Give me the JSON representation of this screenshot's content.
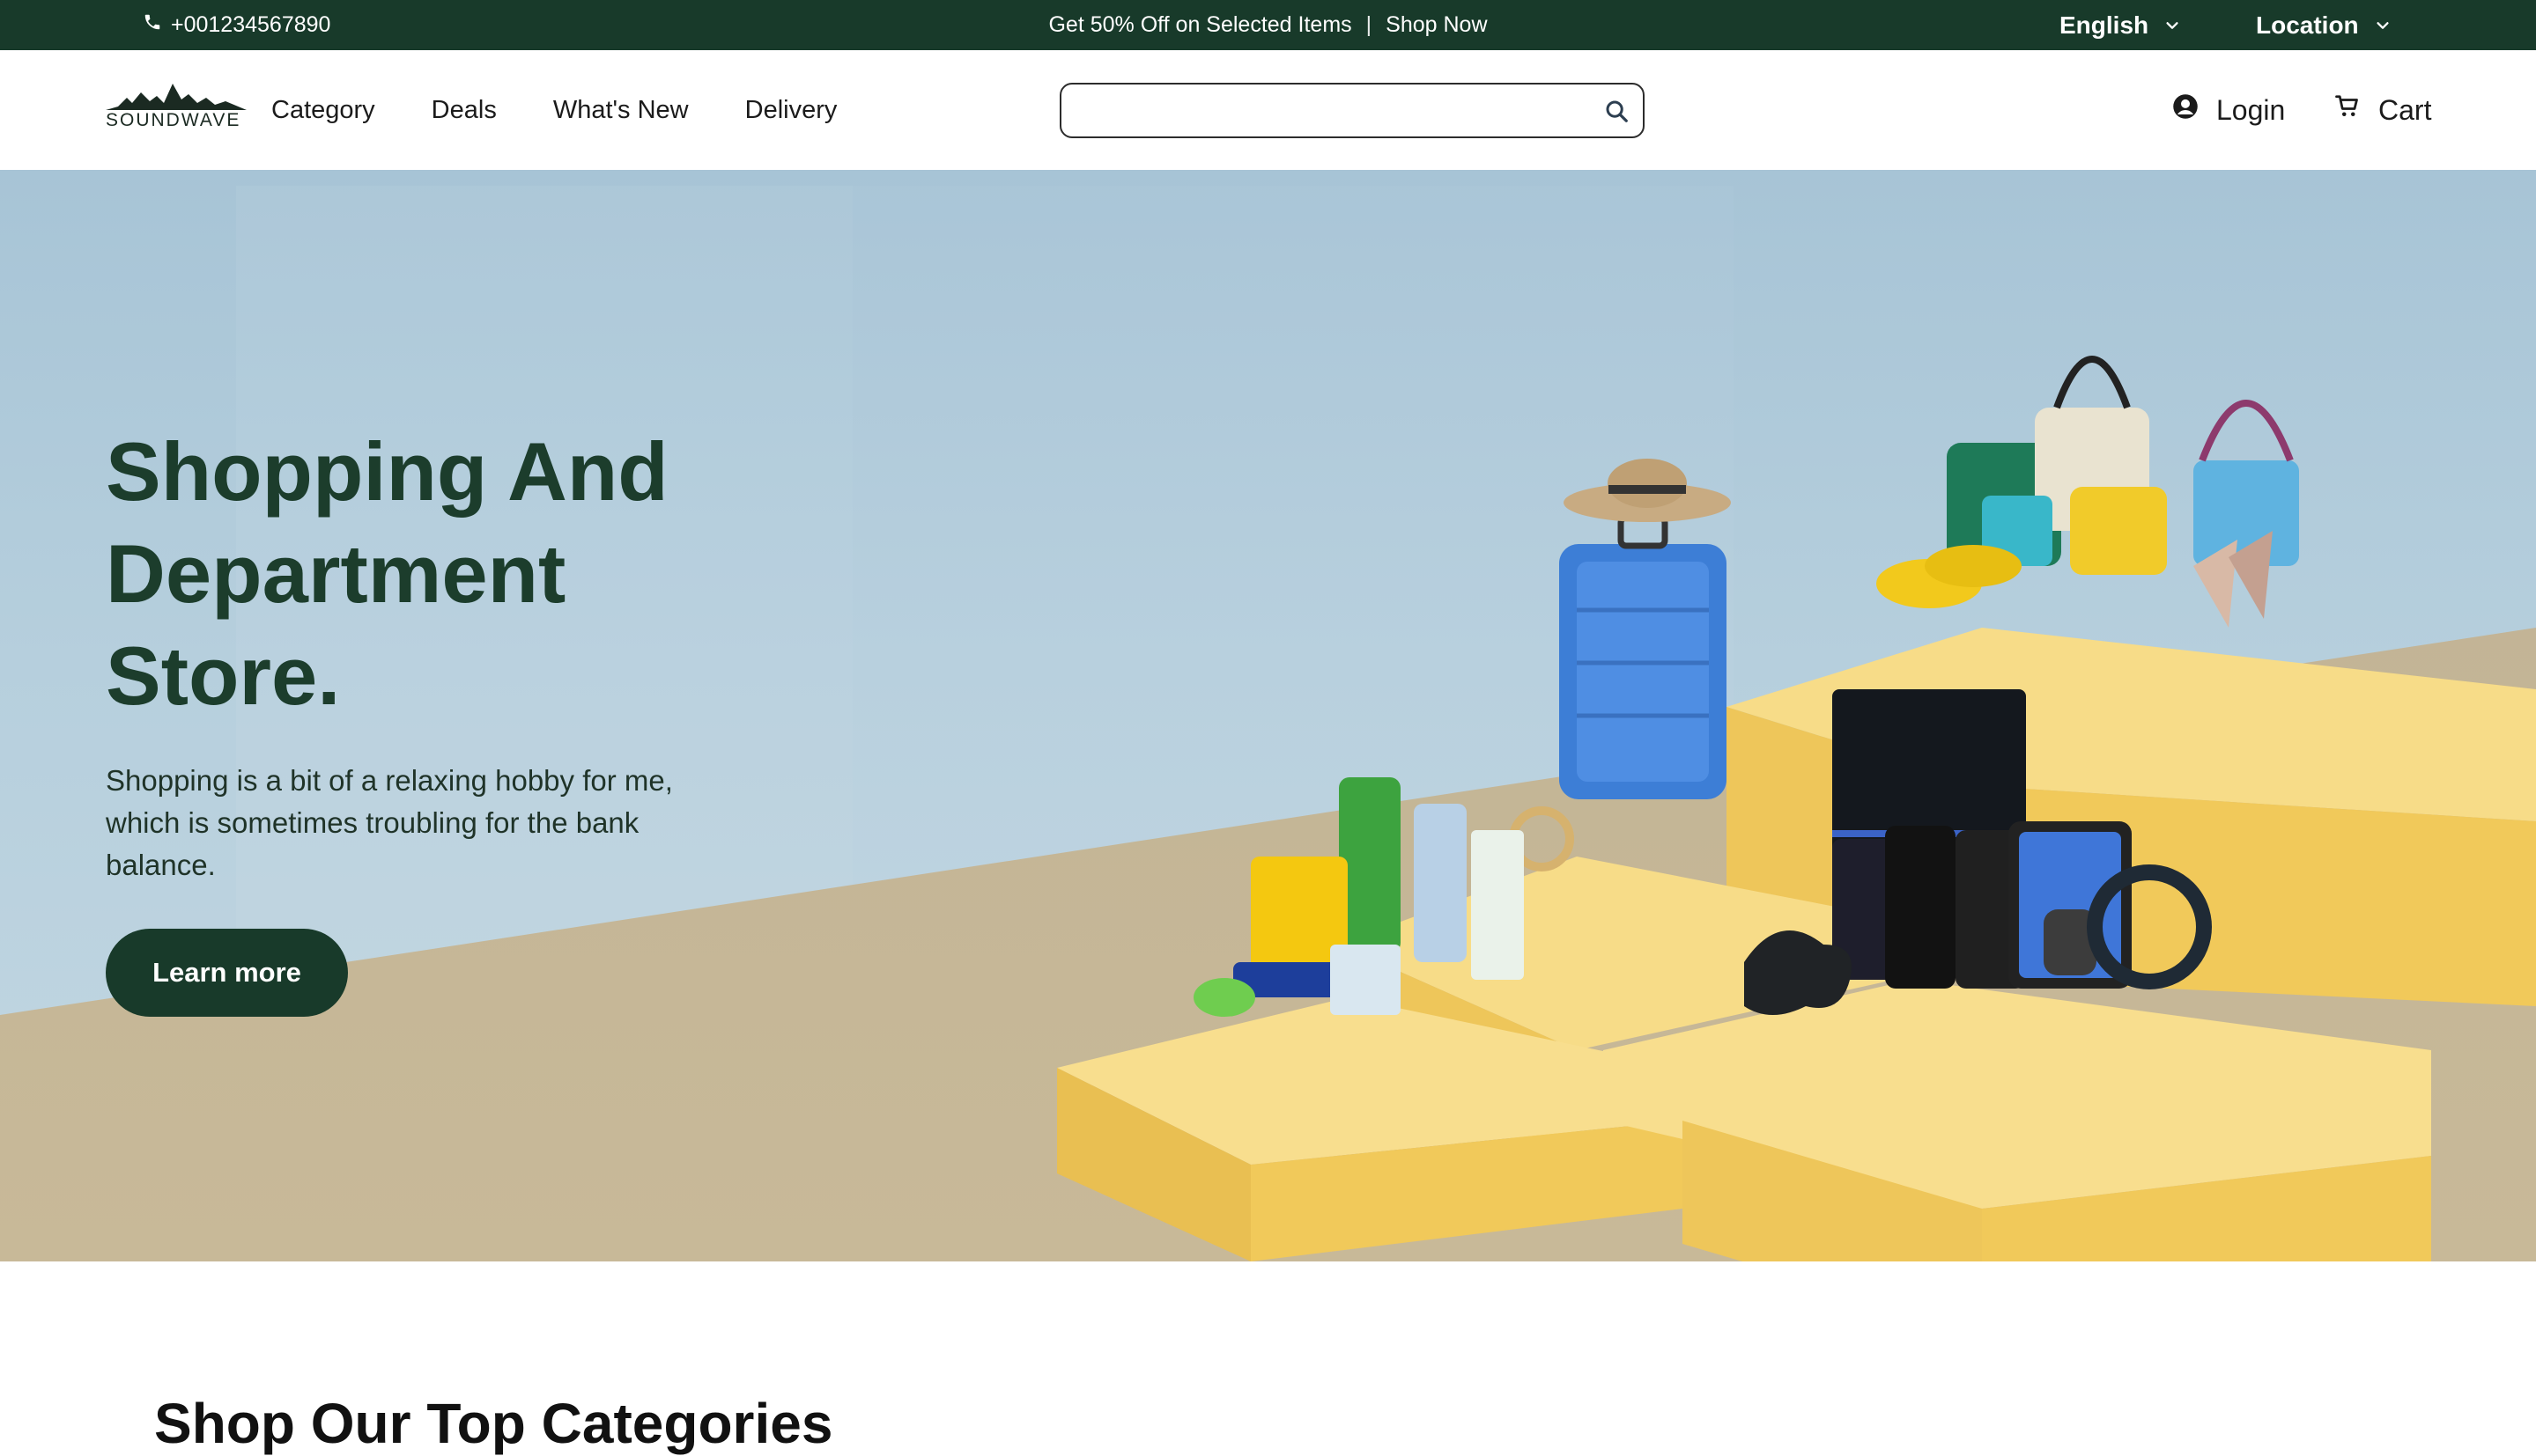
{
  "topbar": {
    "phone": "+001234567890",
    "promo_text": "Get 50% Off on Selected Items",
    "separator": "|",
    "promo_link": "Shop Now",
    "language": "English",
    "location": "Location"
  },
  "header": {
    "logo_text": "SOUNDWAVE",
    "nav": [
      "Category",
      "Deals",
      "What's New",
      "Delivery"
    ],
    "search": {
      "value": "",
      "placeholder": ""
    },
    "login": "Login",
    "cart": "Cart"
  },
  "hero": {
    "title": "Shopping And Department Store.",
    "description": "Shopping is a bit of a relaxing hobby for me, which is sometimes troubling for the bank balance.",
    "cta": "Learn more"
  },
  "section": {
    "title": "Shop Our Top Categories"
  },
  "icons": {
    "phone": "phone-icon",
    "dropdown": "chevron-down-icon",
    "search": "search-icon",
    "user": "user-circle-icon",
    "cart": "cart-icon"
  },
  "colors": {
    "brand_dark_green": "#183a2a",
    "hero_title": "#1c3d2c",
    "podium_yellow": "#f1c95a",
    "sky_blue": "#a7c4d6",
    "floor_beige": "#c8b998"
  }
}
